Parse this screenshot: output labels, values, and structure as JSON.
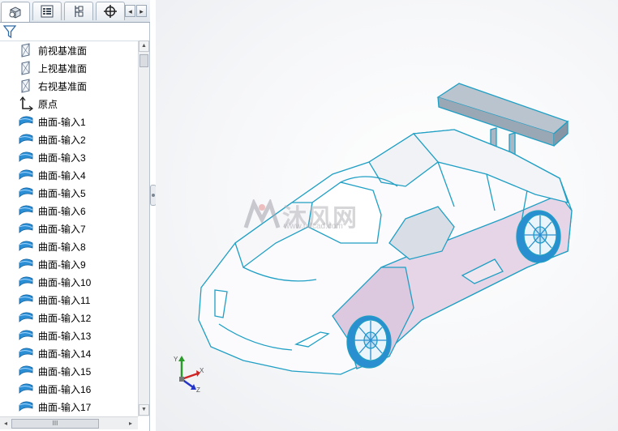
{
  "feature_tree": {
    "items": [
      {
        "label": "前视基准面",
        "icon": "plane-icon"
      },
      {
        "label": "上视基准面",
        "icon": "plane-icon"
      },
      {
        "label": "右视基准面",
        "icon": "plane-icon"
      },
      {
        "label": "原点",
        "icon": "origin-icon"
      },
      {
        "label": "曲面-输入1",
        "icon": "surface-icon"
      },
      {
        "label": "曲面-输入2",
        "icon": "surface-icon"
      },
      {
        "label": "曲面-输入3",
        "icon": "surface-icon"
      },
      {
        "label": "曲面-输入4",
        "icon": "surface-icon"
      },
      {
        "label": "曲面-输入5",
        "icon": "surface-icon"
      },
      {
        "label": "曲面-输入6",
        "icon": "surface-icon"
      },
      {
        "label": "曲面-输入7",
        "icon": "surface-icon"
      },
      {
        "label": "曲面-输入8",
        "icon": "surface-icon"
      },
      {
        "label": "曲面-输入9",
        "icon": "surface-icon"
      },
      {
        "label": "曲面-输入10",
        "icon": "surface-icon"
      },
      {
        "label": "曲面-输入11",
        "icon": "surface-icon"
      },
      {
        "label": "曲面-输入12",
        "icon": "surface-icon"
      },
      {
        "label": "曲面-输入13",
        "icon": "surface-icon"
      },
      {
        "label": "曲面-输入14",
        "icon": "surface-icon"
      },
      {
        "label": "曲面-输入15",
        "icon": "surface-icon"
      },
      {
        "label": "曲面-输入16",
        "icon": "surface-icon"
      },
      {
        "label": "曲面-输入17",
        "icon": "surface-icon"
      }
    ]
  },
  "tabs": [
    {
      "name": "feature-manager-tab",
      "icon": "feature-tree-icon"
    },
    {
      "name": "property-manager-tab",
      "icon": "property-list-icon"
    },
    {
      "name": "configuration-manager-tab",
      "icon": "configuration-icon"
    },
    {
      "name": "dimxpert-tab",
      "icon": "crosshair-icon"
    }
  ],
  "watermark": {
    "text": "沐风网",
    "url": "www.mfcad.com"
  },
  "triad": {
    "x": "X",
    "y": "Y",
    "z": "Z"
  },
  "colors": {
    "model_edge": "#1f9fc4",
    "body_fill": "#e8d6e8",
    "wheel": "#2a8fd0",
    "panel_bg": "#ffffff"
  }
}
